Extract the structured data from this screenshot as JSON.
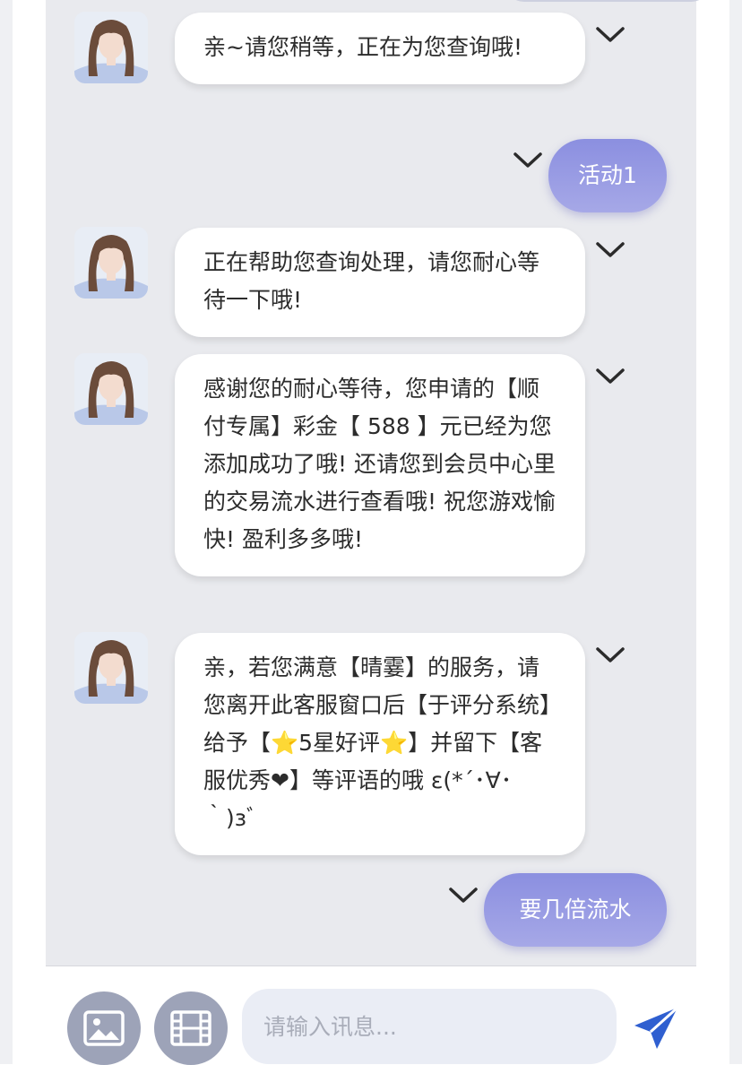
{
  "messages": [
    {
      "sender": "agent",
      "text": "亲~请您稍等，正在为您查询哦!"
    },
    {
      "sender": "user",
      "text": "活动1"
    },
    {
      "sender": "agent",
      "text": "正在帮助您查询处理，请您耐心等待一下哦!"
    },
    {
      "sender": "agent",
      "text": "感谢您的耐心等待，您申请的【顺付专属】彩金【 588 】元已经为您添加成功了哦! 还请您到会员中心里的交易流水进行查看哦! 祝您游戏愉快! 盈利多多哦!"
    },
    {
      "sender": "agent",
      "text": "亲，若您满意【晴霎】的服务，请您离开此客服窗口后【于评分系统】给予【⭐5星好评⭐】并留下【客服优秀❤】等评语的哦 ε(*´･∀･｀)зﾞ"
    },
    {
      "sender": "user",
      "text": "要几倍流水"
    }
  ],
  "input": {
    "placeholder": "请输入讯息..."
  },
  "icons": {
    "message_menu": "chevron-down-icon",
    "image_button": "image-icon",
    "video_button": "film-icon",
    "send_button": "send-icon"
  },
  "colors": {
    "user_bubble": "#8b8fe0",
    "send_icon": "#2f5fd0",
    "chat_background": "#e9eaee"
  }
}
